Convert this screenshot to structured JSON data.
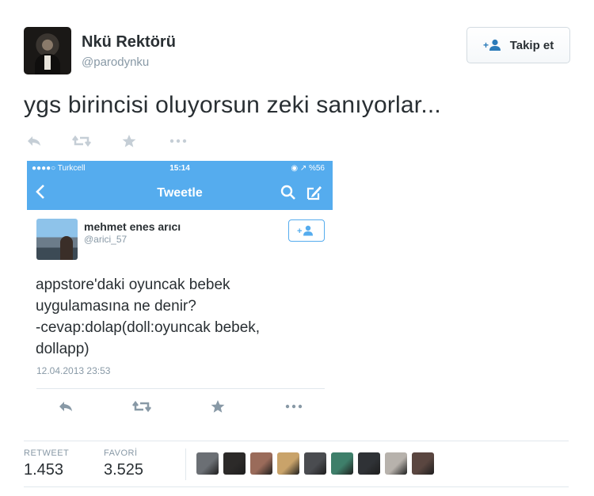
{
  "tweet": {
    "user": {
      "name": "Nkü Rektörü",
      "handle": "@parodynku"
    },
    "follow_button": {
      "label": "Takip et",
      "icon": "follow-person-icon"
    },
    "text": "ygs birincisi oluyorsun zeki sanıyorlar...",
    "actions": [
      {
        "name": "reply-icon"
      },
      {
        "name": "retweet-icon"
      },
      {
        "name": "favorite-star-icon"
      },
      {
        "name": "more-dots-icon"
      }
    ],
    "stats": {
      "retweets": {
        "label": "RETWEET",
        "value": "1.453"
      },
      "favorites": {
        "label": "FAVORİ",
        "value": "3.525"
      }
    },
    "favoriter_avatar_colors": [
      "#6b6f74",
      "#2c2a29",
      "#9a6b5a",
      "#c9a36a",
      "#4a4c50",
      "#3e7f6a",
      "#2f3236",
      "#b7b2ac",
      "#5a4640"
    ]
  },
  "screenshot": {
    "status": {
      "carrier": "●●●●○ Turkcell",
      "time": "15:14",
      "battery": "◉ ↗ %56"
    },
    "nav": {
      "title": "Tweetle"
    },
    "embedded_tweet": {
      "name": "mehmet enes arıcı",
      "handle": "@arici_57",
      "text_lines": [
        "appstore'daki oyuncak bebek",
        "uygulamasına ne denir?",
        "-cevap:dolap(doll:oyuncak bebek,",
        "dollapp)"
      ],
      "date": "12.04.2013 23:53"
    }
  },
  "colors": {
    "accent": "#55acee",
    "text": "#292f33",
    "muted": "#8899a6",
    "icon_muted": "#c5ced6"
  }
}
